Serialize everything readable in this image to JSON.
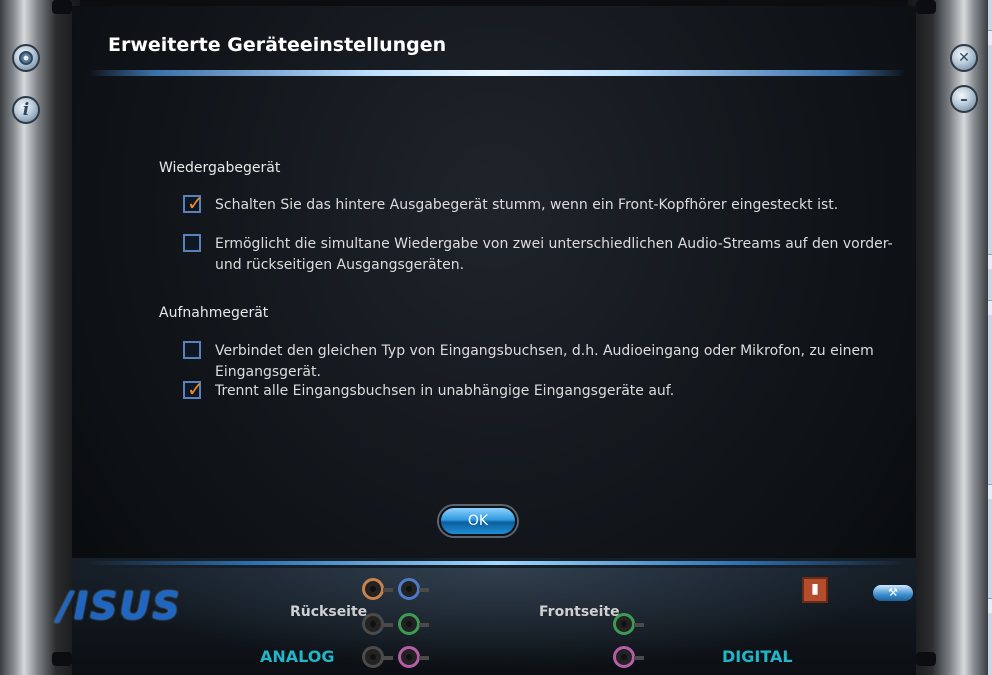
{
  "window": {
    "title": "Erweiterte Geräteeinstellungen"
  },
  "side_buttons": {
    "settings_icon": "gear-icon",
    "info_glyph": "i",
    "close_glyph": "✕",
    "minimize_glyph": "–"
  },
  "sections": {
    "playback": {
      "heading": "Wiedergabegerät",
      "options": [
        {
          "line1": "Schalten Sie das hintere Ausgabegerät stumm, wenn ein Front-Kopfhörer eingesteckt ist.",
          "line2": "",
          "checked": true
        },
        {
          "line1": "Ermöglicht die simultane Wiedergabe von zwei unterschiedlichen Audio-Streams auf den vorder-",
          "line2": "und rückseitigen Ausgangsgeräten.",
          "checked": false
        }
      ]
    },
    "recording": {
      "heading": "Aufnahmegerät",
      "options": [
        {
          "line1": "Verbindet den gleichen Typ von Eingangsbuchsen, d.h. Audioeingang oder Mikrofon, zu einem",
          "line2": "Eingangsgerät.",
          "checked": false
        },
        {
          "line1": "Trennt alle Eingangsbuchsen in unabhängige Eingangsgeräte auf.",
          "line2": "",
          "checked": true
        }
      ]
    }
  },
  "checkmark_glyph": "✓",
  "ok_button": {
    "label": "OK"
  },
  "footer": {
    "logo": "/ISUS",
    "rear_label": "Rückseite",
    "front_label": "Frontseite",
    "analog_label": "ANALOG",
    "digital_label": "DIGITAL",
    "jack_colors": {
      "orange": "#c9814c",
      "blue": "#4e7ac8",
      "black": "#4a4a4a",
      "green": "#3d9a52",
      "pink": "#b45ea8"
    }
  },
  "colors": {
    "accent_blue": "#2f9be0",
    "check_orange": "#f08a24",
    "label_cyan": "#22b5c8"
  }
}
